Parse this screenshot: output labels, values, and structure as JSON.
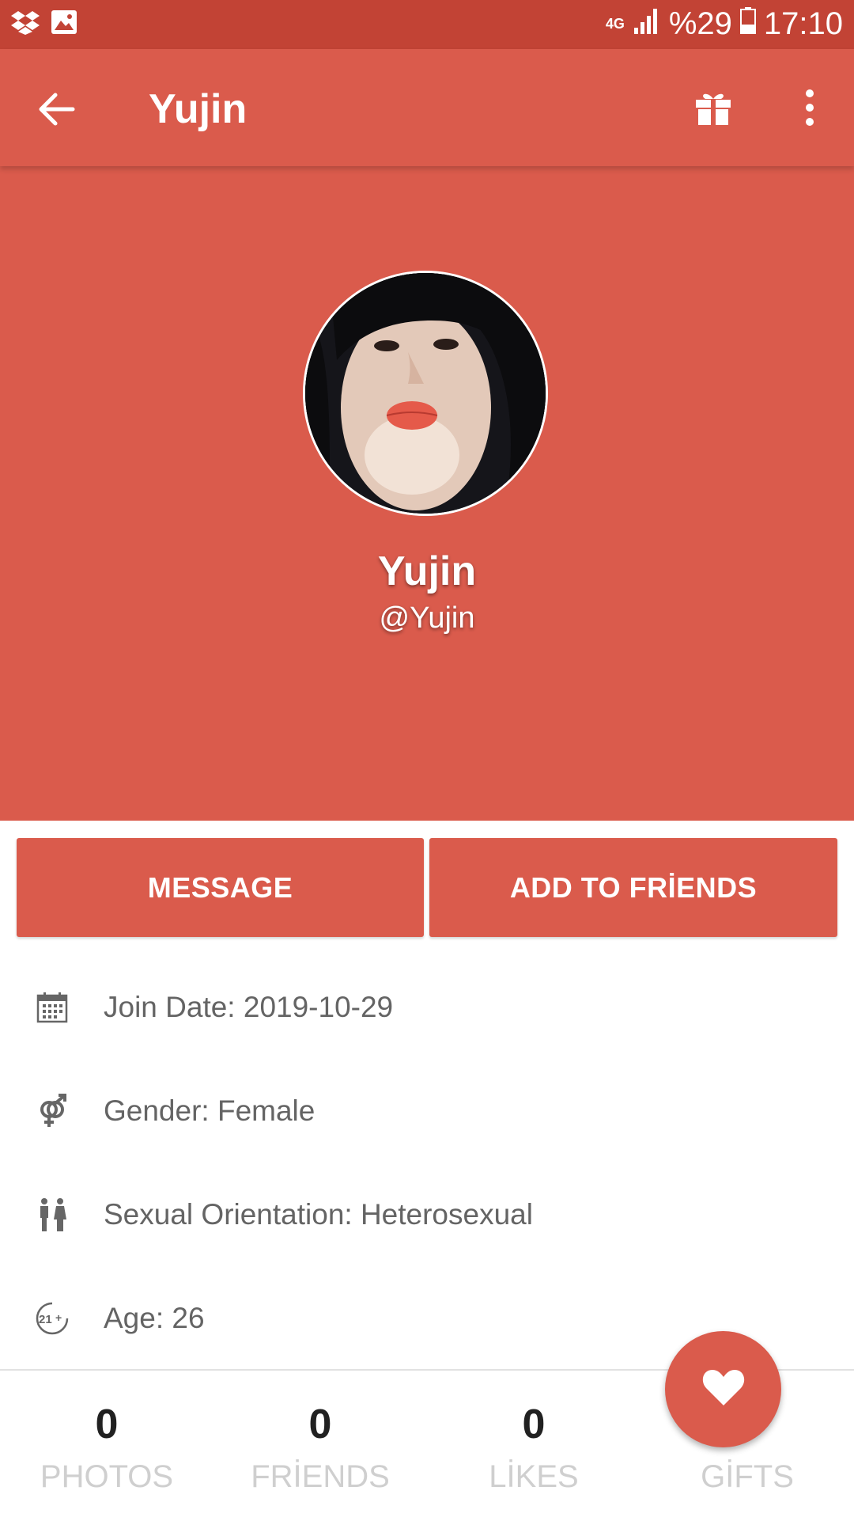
{
  "status_bar": {
    "network": "4G",
    "battery": "%29",
    "time": "17:10",
    "icons": [
      "dropbox-icon",
      "image-icon",
      "signal-icon",
      "battery-icon"
    ]
  },
  "app_bar": {
    "title": "Yujin",
    "icons": [
      "back-arrow-icon",
      "gift-icon",
      "more-vert-icon"
    ]
  },
  "profile": {
    "name": "Yujin",
    "username": "@Yujin"
  },
  "actions": {
    "message": "MESSAGE",
    "add_friends": "ADD TO FRİENDS"
  },
  "info": [
    {
      "icon": "calendar-icon",
      "text": "Join Date: 2019-10-29"
    },
    {
      "icon": "gender-icon",
      "text": "Gender: Female"
    },
    {
      "icon": "couple-icon",
      "text": "Sexual Orientation: Heterosexual"
    },
    {
      "icon": "age-21-plus-icon",
      "text": "Age: 26"
    }
  ],
  "stats": [
    {
      "value": "0",
      "label": "PHOTOS"
    },
    {
      "value": "0",
      "label": "FRİENDS"
    },
    {
      "value": "0",
      "label": "LİKES"
    },
    {
      "value": "",
      "label": "GİFTS"
    }
  ],
  "fab_icon": "heart-icon",
  "colors": {
    "primary": "#da5b4c",
    "status_bar": "#c24335",
    "text_gray": "#646464",
    "label_gray": "#cfcfcf"
  }
}
